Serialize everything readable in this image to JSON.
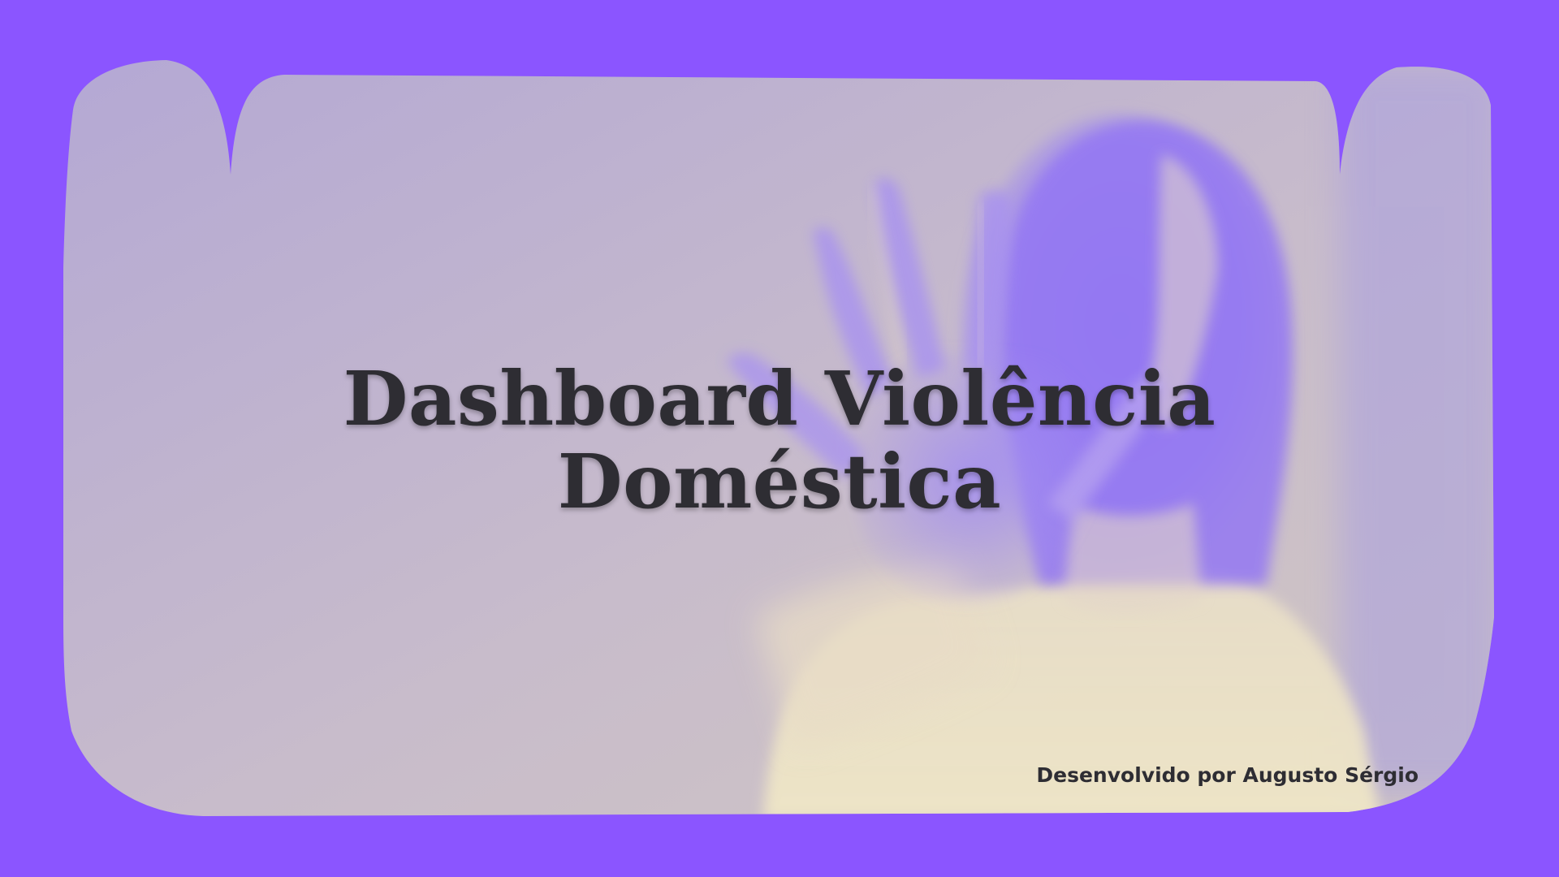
{
  "title": {
    "line1": "Dashboard Violência",
    "line2": "Doméstica"
  },
  "credit": "Desenvolvido por Augusto Sérgio",
  "colors": {
    "background": "#8b55ff",
    "panel_light": "#cfc6c6",
    "panel_tint": "#b4a8d6",
    "figure_purple": "#9478f3",
    "figure_highlight": "#eee5c7",
    "text": "#2e2d33"
  },
  "image": {
    "subject": "person-raising-open-hand-photo"
  }
}
